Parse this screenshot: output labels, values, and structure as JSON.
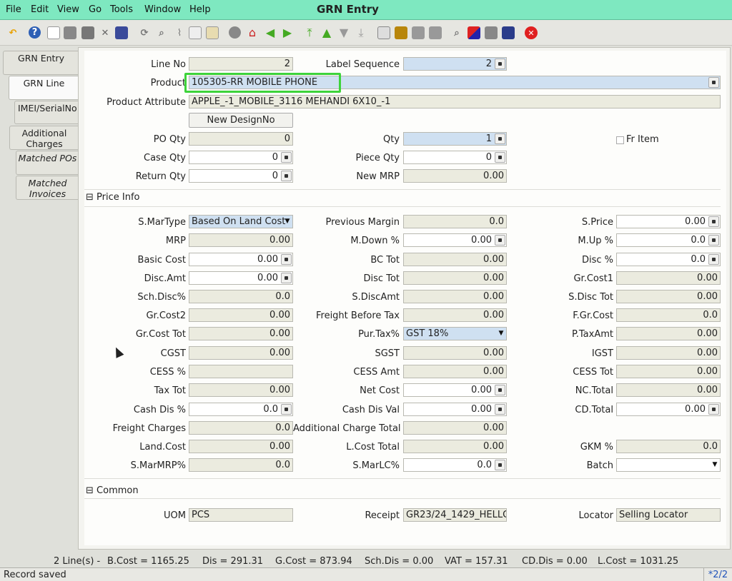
{
  "menu": {
    "file": "File",
    "edit": "Edit",
    "view": "View",
    "go": "Go",
    "tools": "Tools",
    "window": "Window",
    "help": "Help"
  },
  "window_title": "GRN Entry",
  "toolbar_icons": [
    "undo-icon",
    "help-icon",
    "new-icon",
    "copy-icon",
    "delete-icon",
    "cancel-icon",
    "save-icon",
    "refresh-icon",
    "find-icon",
    "attach-icon",
    "chat-icon",
    "grid-toggle-icon",
    "history-icon",
    "home-icon",
    "back-icon",
    "forward-icon",
    "first-record-icon",
    "previous-record-icon",
    "next-record-icon",
    "last-record-icon",
    "report-icon",
    "archive-icon",
    "print-icon",
    "print-preview-icon",
    "zoom-across-icon",
    "workflow-icon",
    "product-info-icon",
    "save-exit-icon",
    "close-icon"
  ],
  "tabs": {
    "grn_entry": "GRN Entry",
    "grn_line": "GRN Line",
    "imei": "IMEI/SerialNo",
    "additional_charges": "Additional Charges",
    "matched_pos": "Matched POs",
    "matched_invoices": "Matched Invoices"
  },
  "form": {
    "line_no": {
      "label": "Line No",
      "value": "2"
    },
    "label_sequence": {
      "label": "Label Sequence",
      "value": "2"
    },
    "product": {
      "label": "Product",
      "value": "105305-RR MOBILE PHONE"
    },
    "product_attribute": {
      "label": "Product Attribute",
      "value": "APPLE_-1_MOBILE_3116 MEHANDI 6X10_-1"
    },
    "new_designno": "New DesignNo",
    "po_qty": {
      "label": "PO Qty",
      "value": "0"
    },
    "qty": {
      "label": "Qty",
      "value": "1"
    },
    "fr_item": "Fr Item",
    "case_qty": {
      "label": "Case Qty",
      "value": "0"
    },
    "piece_qty": {
      "label": "Piece Qty",
      "value": "0"
    },
    "return_qty": {
      "label": "Return Qty",
      "value": "0"
    },
    "new_mrp": {
      "label": "New MRP",
      "value": "0.00"
    }
  },
  "price_info": {
    "title": "Price Info",
    "s_martype": {
      "label": "S.MarType",
      "value": "Based On Land Cost"
    },
    "previous_margin": {
      "label": "Previous Margin",
      "value": "0.0"
    },
    "s_price": {
      "label": "S.Price",
      "value": "0.00"
    },
    "mrp": {
      "label": "MRP",
      "value": "0.00"
    },
    "m_down": {
      "label": "M.Down %",
      "value": "0.00"
    },
    "m_up": {
      "label": "M.Up %",
      "value": "0.0"
    },
    "basic_cost": {
      "label": "Basic Cost",
      "value": "0.00"
    },
    "bc_tot": {
      "label": "BC Tot",
      "value": "0.00"
    },
    "disc_pct": {
      "label": "Disc %",
      "value": "0.0"
    },
    "disc_amt": {
      "label": "Disc.Amt",
      "value": "0.00"
    },
    "disc_tot": {
      "label": "Disc Tot",
      "value": "0.00"
    },
    "gr_cost1": {
      "label": "Gr.Cost1",
      "value": "0.00"
    },
    "sch_disc": {
      "label": "Sch.Disc%",
      "value": "0.0"
    },
    "s_discamt": {
      "label": "S.DiscAmt",
      "value": "0.00"
    },
    "s_disc_tot": {
      "label": "S.Disc Tot",
      "value": "0.00"
    },
    "gr_cost2": {
      "label": "Gr.Cost2",
      "value": "0.00"
    },
    "freight_before_tax": {
      "label": "Freight Before Tax",
      "value": "0.00"
    },
    "f_gr_cost": {
      "label": "F.Gr.Cost",
      "value": "0.0"
    },
    "gr_cost_tot": {
      "label": "Gr.Cost Tot",
      "value": "0.00"
    },
    "pur_tax": {
      "label": "Pur.Tax%",
      "value": "GST 18%"
    },
    "p_taxamt": {
      "label": "P.TaxAmt",
      "value": "0.00"
    },
    "cgst": {
      "label": "CGST",
      "value": "0.00"
    },
    "sgst": {
      "label": "SGST",
      "value": "0.00"
    },
    "igst": {
      "label": "IGST",
      "value": "0.00"
    },
    "cess_pct": {
      "label": "CESS %",
      "value": ""
    },
    "cess_amt": {
      "label": "CESS Amt",
      "value": "0.00"
    },
    "cess_tot": {
      "label": "CESS Tot",
      "value": "0.00"
    },
    "tax_tot": {
      "label": "Tax Tot",
      "value": "0.00"
    },
    "net_cost": {
      "label": "Net Cost",
      "value": "0.00"
    },
    "nc_total": {
      "label": "NC.Total",
      "value": "0.00"
    },
    "cash_dis": {
      "label": "Cash Dis %",
      "value": "0.0"
    },
    "cash_dis_val": {
      "label": "Cash Dis Val",
      "value": "0.00"
    },
    "cd_total": {
      "label": "CD.Total",
      "value": "0.00"
    },
    "freight_charges": {
      "label": "Freight Charges",
      "value": "0.0"
    },
    "additional_charge_total": {
      "label": "Additional Charge Total",
      "value": "0.00"
    },
    "land_cost": {
      "label": "Land.Cost",
      "value": "0.00"
    },
    "l_cost_total": {
      "label": "L.Cost Total",
      "value": "0.00"
    },
    "gkm": {
      "label": "GKM %",
      "value": "0.0"
    },
    "s_marmrp": {
      "label": "S.MarMRP%",
      "value": "0.0"
    },
    "s_marlc": {
      "label": "S.MarLC%",
      "value": "0.0"
    },
    "batch": {
      "label": "Batch",
      "value": ""
    }
  },
  "common": {
    "title": "Common",
    "uom": {
      "label": "UOM",
      "value": "PCS"
    },
    "receipt": {
      "label": "Receipt",
      "value": "GR23/24_1429_HELLC"
    },
    "locator": {
      "label": "Locator",
      "value": "Selling Locator"
    }
  },
  "summary": {
    "lines": "2 Line(s) -",
    "bcost": "B.Cost = 1165.25",
    "dis": "Dis = 291.31",
    "gcost": "G.Cost = 873.94",
    "schdis": "Sch.Dis = 0.00",
    "vat": "VAT = 157.31",
    "cddis": "CD.Dis = 0.00",
    "lcost": "L.Cost = 1031.25"
  },
  "status": {
    "message": "Record saved",
    "record": "*2/2"
  }
}
